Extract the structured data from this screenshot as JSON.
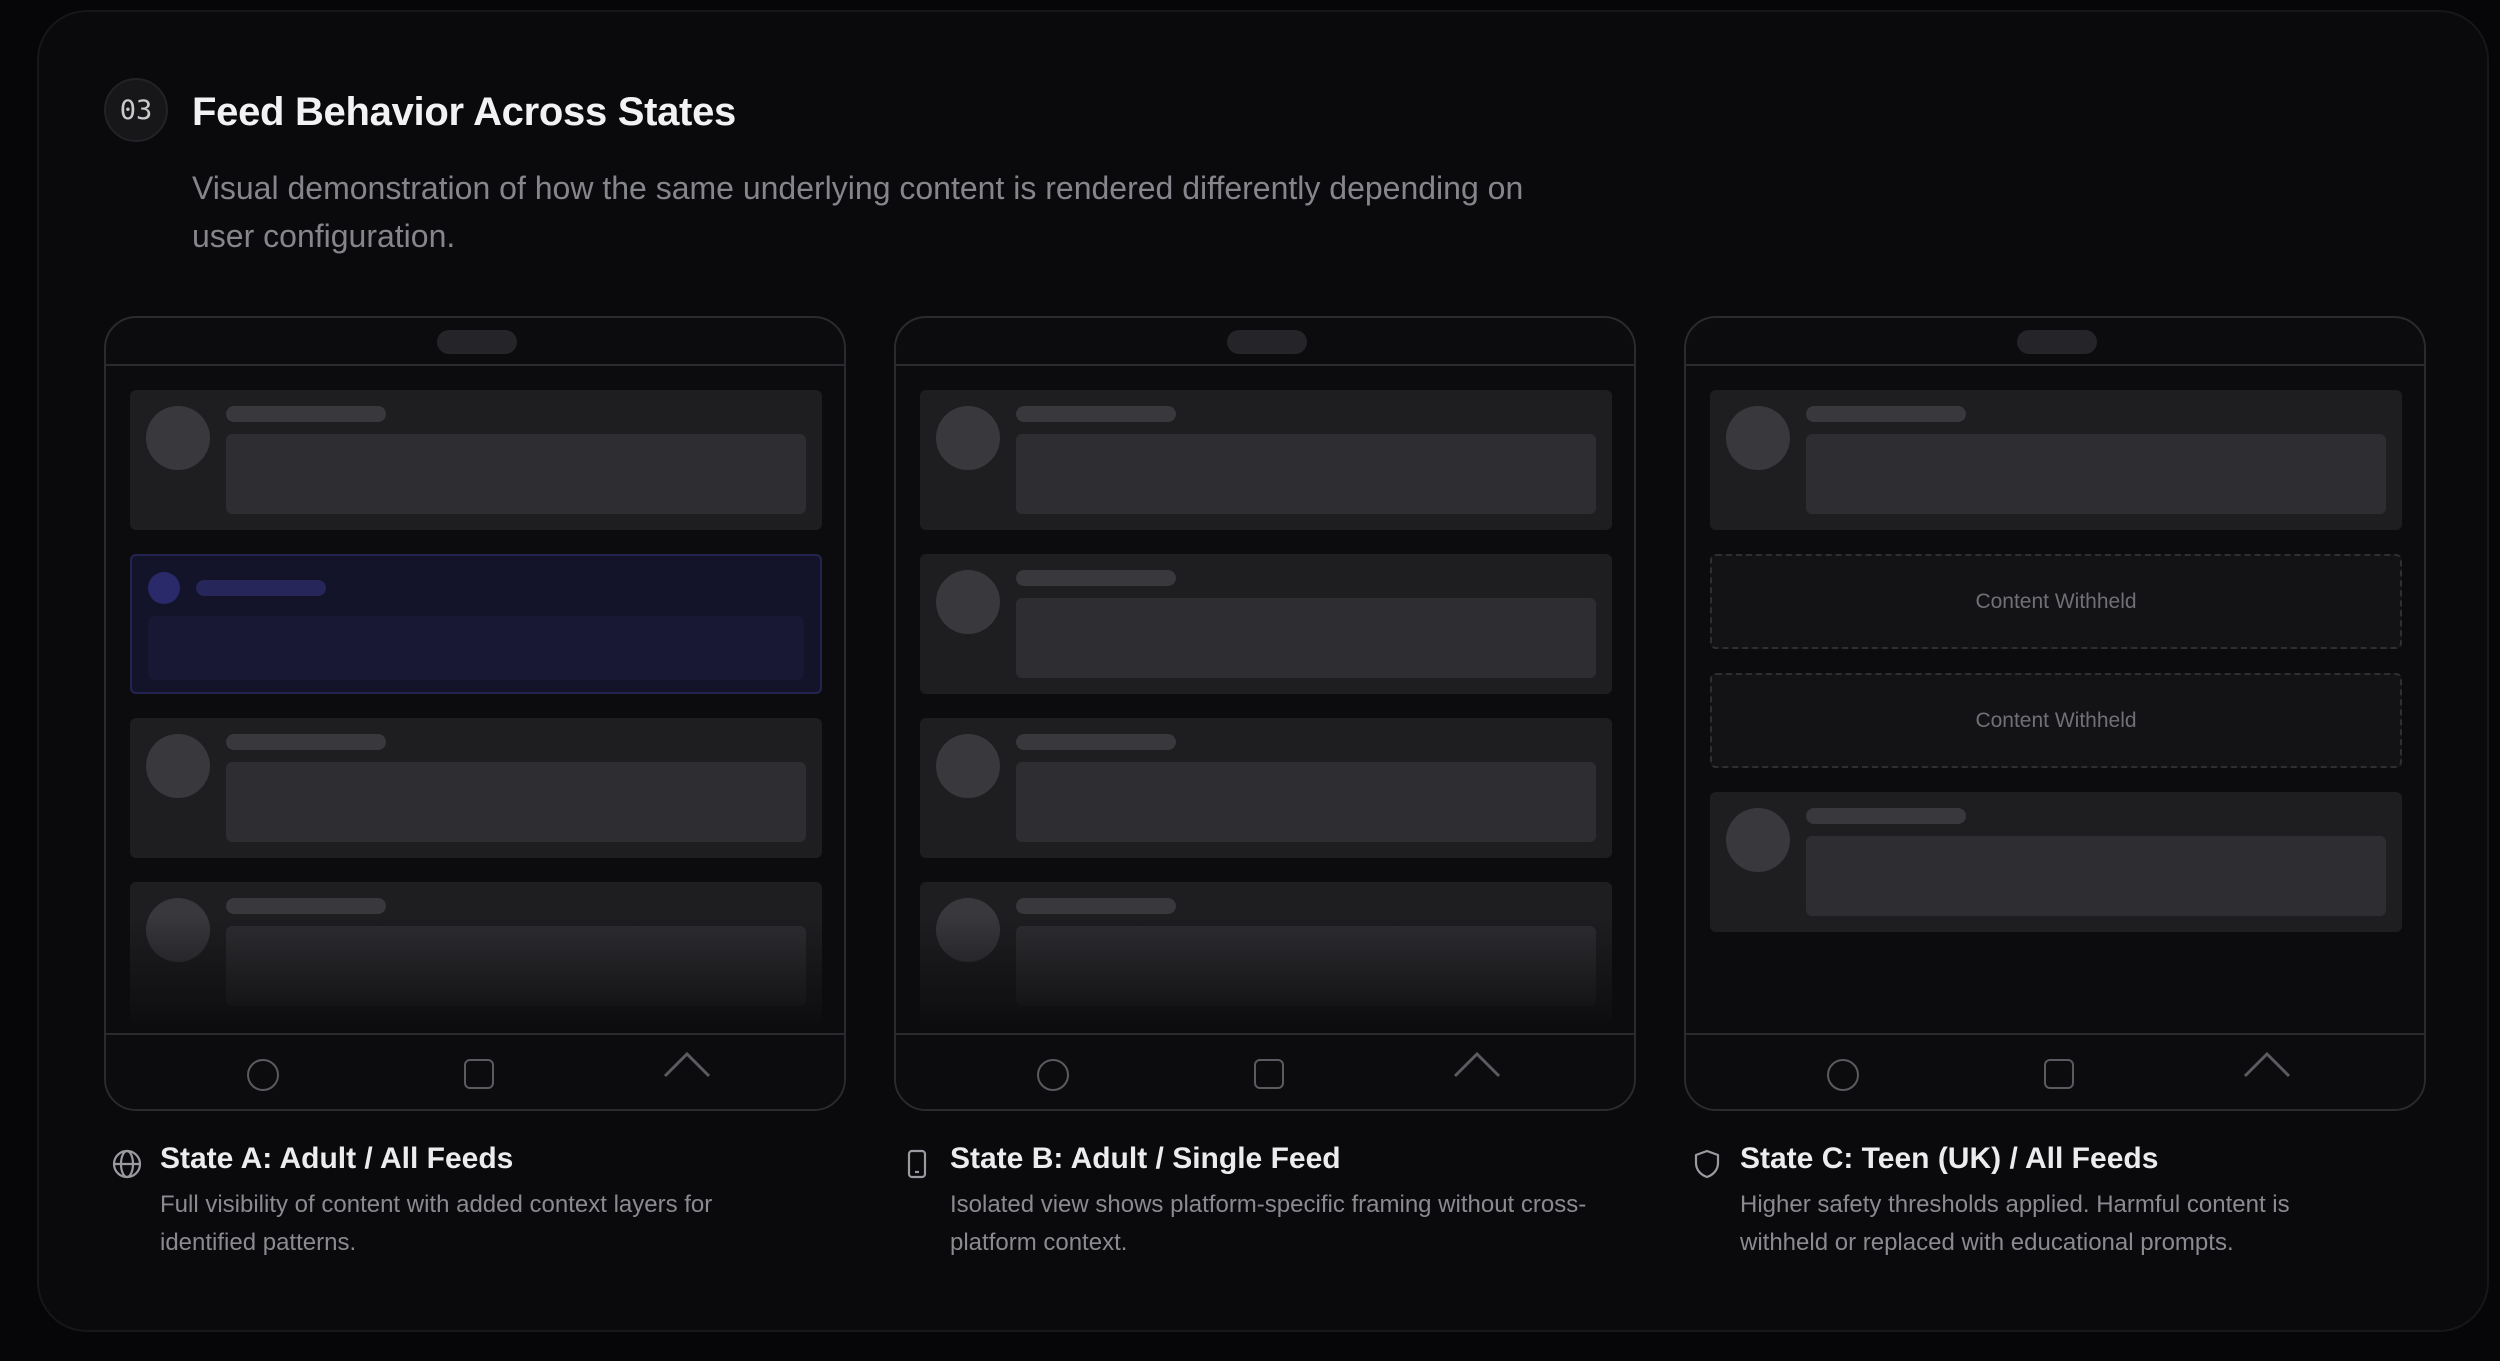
{
  "section": {
    "number": "03",
    "title": "Feed Behavior Across States",
    "description": "Visual demonstration of how the same underlying content is rendered differently depending on user configuration."
  },
  "states": [
    {
      "title": "State A: Adult / All Feeds",
      "description": "Full visibility of content with added context layers for identified patterns.",
      "icon": "globe-icon"
    },
    {
      "title": "State B: Adult / Single Feed",
      "description": "Isolated view shows platform-specific framing without cross-platform context.",
      "icon": "phone-icon"
    },
    {
      "title": "State C: Teen (UK) / All Feeds",
      "description": "Higher safety thresholds applied. Harmful content is withheld or replaced with educational prompts.",
      "icon": "shield-icon",
      "withheld_label_1": "Content Withheld",
      "withheld_label_2": "Content Withheld"
    }
  ],
  "colors": {
    "background": "#0a0a0c",
    "card": "#1e1e21",
    "context_layer": "#13132a",
    "text_primary": "#f2f2f4",
    "text_secondary": "#85858c"
  }
}
